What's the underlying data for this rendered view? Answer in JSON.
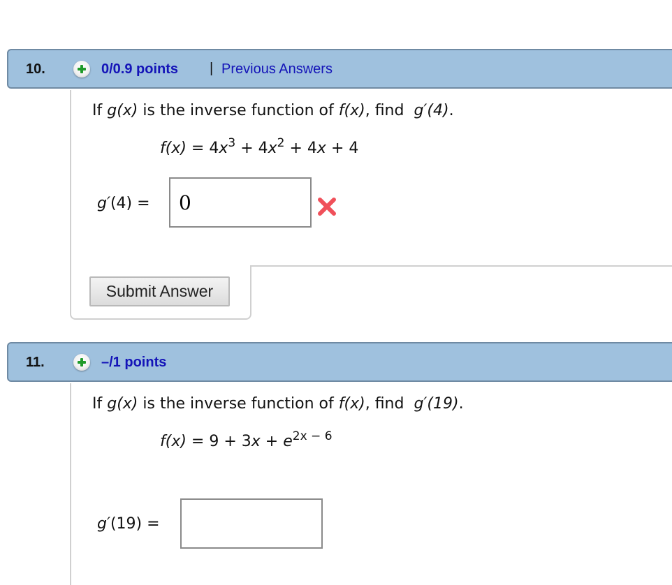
{
  "questions": [
    {
      "number": "10.",
      "points": "0/0.9 points",
      "separator": "|",
      "previous_answers_label": "Previous Answers",
      "prompt": {
        "prefix": "If ",
        "g": "g(x)",
        "middle": " is the inverse function of ",
        "f": "f(x)",
        "suffix": ", find ",
        "target": "g′(4)",
        "end": "."
      },
      "formula": {
        "lhs": "f(x)",
        "eq": " = 4",
        "x1": "x",
        "exp1": "3",
        "plus1": " + 4",
        "x2": "x",
        "exp2": "2",
        "plus2": " + 4",
        "x3": "x",
        "tail": " + 4"
      },
      "answer_label_g": "g′",
      "answer_label_rest": "(4) =",
      "answer_value": "0",
      "answer_status": "incorrect",
      "submit_label": "Submit Answer"
    },
    {
      "number": "11.",
      "points": "–/1 points",
      "prompt": {
        "prefix": "If ",
        "g": "g(x)",
        "middle": " is the inverse function of ",
        "f": "f(x)",
        "suffix": ", find ",
        "target": "g′(19)",
        "end": "."
      },
      "formula": {
        "lhs": "f(x)",
        "eq": " = 9 + 3",
        "x1": "x",
        "plus1": " + ",
        "e": "e",
        "exp": "2x − 6"
      },
      "answer_label_g": "g′",
      "answer_label_rest": "(19) =",
      "answer_value": ""
    }
  ],
  "icons": {
    "points_icon": "plus-circle-icon",
    "status_icon": "red-x-icon"
  },
  "colors": {
    "header_bg": "#9fc1de",
    "link": "#1414b8",
    "incorrect": "#f0505a",
    "plus": "#1f9a2a"
  }
}
